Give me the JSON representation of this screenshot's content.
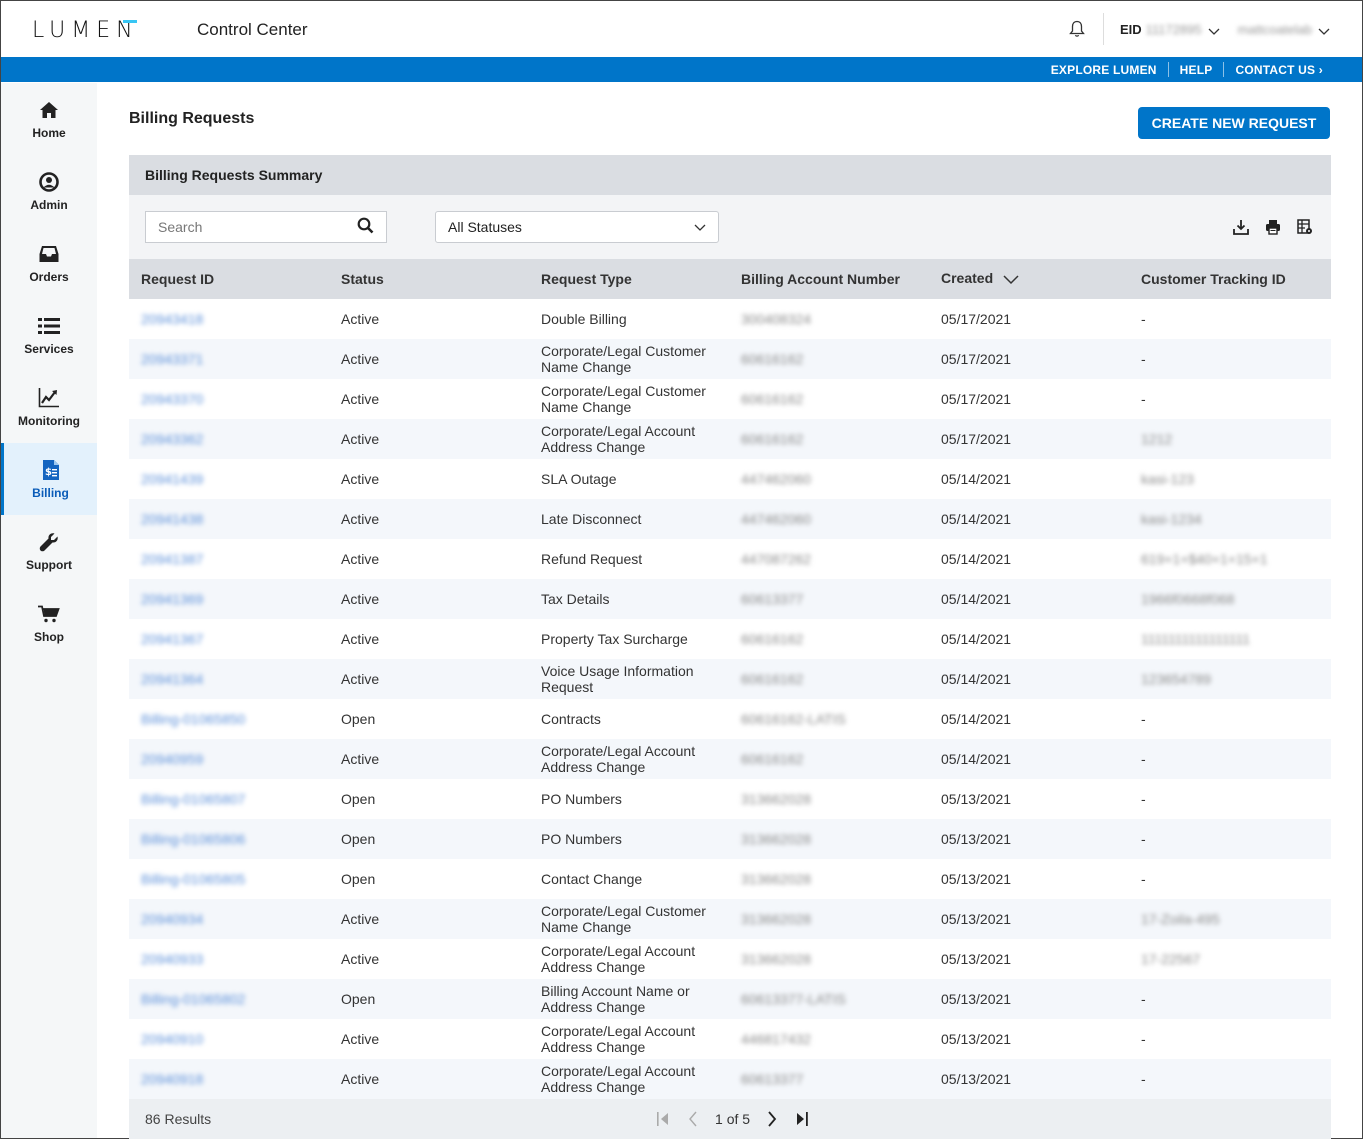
{
  "header": {
    "brand": "LUMEN",
    "app_title": "Control Center",
    "eid_label": "EID",
    "eid_value": "11172895",
    "user_name": "mattcoatelab",
    "links": [
      "EXPLORE LUMEN",
      "HELP",
      "CONTACT US"
    ]
  },
  "sidebar": {
    "items": [
      {
        "label": "Home",
        "icon": "home-icon",
        "active": false
      },
      {
        "label": "Admin",
        "icon": "user-circle-icon",
        "active": false
      },
      {
        "label": "Orders",
        "icon": "inbox-icon",
        "active": false
      },
      {
        "label": "Services",
        "icon": "list-icon",
        "active": false
      },
      {
        "label": "Monitoring",
        "icon": "chart-line-icon",
        "active": false
      },
      {
        "label": "Billing",
        "icon": "invoice-icon",
        "active": true
      },
      {
        "label": "Support",
        "icon": "wrench-icon",
        "active": false
      },
      {
        "label": "Shop",
        "icon": "cart-icon",
        "active": false
      }
    ]
  },
  "page": {
    "title": "Billing Requests",
    "create_button": "CREATE NEW REQUEST",
    "panel_title": "Billing Requests Summary",
    "search_placeholder": "Search",
    "status_filter": "All Statuses"
  },
  "table": {
    "columns": [
      "Request ID",
      "Status",
      "Request Type",
      "Billing Account Number",
      "Created",
      "Customer Tracking ID"
    ],
    "rows": [
      {
        "id": "20943418",
        "status": "Active",
        "type": "Double Billing",
        "account": "300408324",
        "created": "05/17/2021",
        "tracking": "-"
      },
      {
        "id": "20943371",
        "status": "Active",
        "type": "Corporate/Legal Customer Name Change",
        "account": "60616162",
        "created": "05/17/2021",
        "tracking": "-"
      },
      {
        "id": "20943370",
        "status": "Active",
        "type": "Corporate/Legal Customer Name Change",
        "account": "60616162",
        "created": "05/17/2021",
        "tracking": "-"
      },
      {
        "id": "20943362",
        "status": "Active",
        "type": "Corporate/Legal Account Address Change",
        "account": "60616162",
        "created": "05/17/2021",
        "tracking": "1212"
      },
      {
        "id": "20941439",
        "status": "Active",
        "type": "SLA Outage",
        "account": "447462060",
        "created": "05/14/2021",
        "tracking": "kasi-123"
      },
      {
        "id": "20941438",
        "status": "Active",
        "type": "Late Disconnect",
        "account": "447462060",
        "created": "05/14/2021",
        "tracking": "kasi-1234"
      },
      {
        "id": "20941387",
        "status": "Active",
        "type": "Refund Request",
        "account": "447087262",
        "created": "05/14/2021",
        "tracking": "619+1+$40+1+15+1"
      },
      {
        "id": "20941369",
        "status": "Active",
        "type": "Tax Details",
        "account": "60613377",
        "created": "05/14/2021",
        "tracking": "1966f0668f068"
      },
      {
        "id": "20941367",
        "status": "Active",
        "type": "Property Tax Surcharge",
        "account": "60616162",
        "created": "05/14/2021",
        "tracking": "1111111111111111"
      },
      {
        "id": "20941364",
        "status": "Active",
        "type": "Voice Usage Information Request",
        "account": "60616162",
        "created": "05/14/2021",
        "tracking": "123654789"
      },
      {
        "id": "Billing-01065850",
        "status": "Open",
        "type": "Contracts",
        "account": "60616162-LATIS",
        "created": "05/14/2021",
        "tracking": "-"
      },
      {
        "id": "20940959",
        "status": "Active",
        "type": "Corporate/Legal Account Address Change",
        "account": "60616162",
        "created": "05/14/2021",
        "tracking": "-"
      },
      {
        "id": "Billing-01065807",
        "status": "Open",
        "type": "PO Numbers",
        "account": "313662028",
        "created": "05/13/2021",
        "tracking": "-"
      },
      {
        "id": "Billing-01065806",
        "status": "Open",
        "type": "PO Numbers",
        "account": "313662028",
        "created": "05/13/2021",
        "tracking": "-"
      },
      {
        "id": "Billing-01065805",
        "status": "Open",
        "type": "Contact Change",
        "account": "313662028",
        "created": "05/13/2021",
        "tracking": "-"
      },
      {
        "id": "20940934",
        "status": "Active",
        "type": "Corporate/Legal Customer Name Change",
        "account": "313662028",
        "created": "05/13/2021",
        "tracking": "17-Zoila-495"
      },
      {
        "id": "20940933",
        "status": "Active",
        "type": "Corporate/Legal Account Address Change",
        "account": "313662028",
        "created": "05/13/2021",
        "tracking": "17-22567"
      },
      {
        "id": "Billing-01065802",
        "status": "Open",
        "type": "Billing Account Name or Address Change",
        "account": "60613377-LATIS",
        "created": "05/13/2021",
        "tracking": "-"
      },
      {
        "id": "20940910",
        "status": "Active",
        "type": "Corporate/Legal Account Address Change",
        "account": "44681743​2",
        "created": "05/13/2021",
        "tracking": "-"
      },
      {
        "id": "20940918",
        "status": "Active",
        "type": "Corporate/Legal Account Address Change",
        "account": "60613377",
        "created": "05/13/2021",
        "tracking": "-"
      }
    ]
  },
  "footer": {
    "results": "86 Results",
    "page_current": "1",
    "page_of": "of",
    "page_total": "5"
  },
  "colors": {
    "brand_blue": "#0075c9",
    "active_nav_bg": "#e3f1fc",
    "header_gray": "#dadde2",
    "link_blue": "#5b8fd9"
  }
}
